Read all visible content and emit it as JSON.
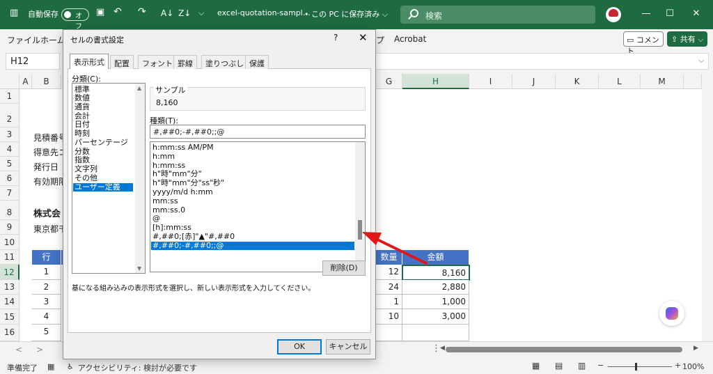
{
  "titlebar": {
    "autosave_label": "自動保存",
    "autosave_state": "オフ",
    "filename": "excel-quotation-sampl…",
    "save_location": "• この PC に保存済み ⌵",
    "search_placeholder": "検索",
    "accent_color": "#1e6b41"
  },
  "ribbon": {
    "file": "ファイル",
    "home": "ホーム",
    "help_fragment": "プ",
    "acrobat": "Acrobat",
    "comment_button": "コメント",
    "share_button": "共有 ⌵"
  },
  "formula_bar": {
    "name_box": "H12",
    "formula": ""
  },
  "grid": {
    "columns": [
      "A",
      "B",
      "G",
      "H",
      "I",
      "J",
      "K",
      "L",
      "M"
    ],
    "selected_column": "H",
    "rows": [
      "1",
      "2",
      "3",
      "4",
      "5",
      "6",
      "7",
      "8",
      "9",
      "10",
      "11",
      "12",
      "13",
      "14",
      "15",
      "16"
    ],
    "selected_row": "12",
    "partial_texts": {
      "r3": "見積番号",
      "r4": "得意先コ",
      "r5": "発行日",
      "r6": "有効期限",
      "r8": "株式会",
      "r9": "東京都千"
    },
    "table": {
      "header_row_label": "行",
      "header_qty": "数量",
      "header_amount": "金額",
      "rows": [
        {
          "no": "1",
          "qty": "12",
          "amount": "8,160"
        },
        {
          "no": "2",
          "qty": "24",
          "amount": "2,880"
        },
        {
          "no": "3",
          "qty": "1",
          "amount": "1,000"
        },
        {
          "no": "4",
          "qty": "10",
          "amount": "3,000"
        },
        {
          "no": "5",
          "qty": "",
          "amount": ""
        }
      ],
      "header_color": "#4472c4"
    }
  },
  "dialog": {
    "title": "セルの書式設定",
    "help": "?",
    "close": "✕",
    "tabs": [
      "表示形式",
      "配置",
      "フォント",
      "罫線",
      "塗りつぶし",
      "保護"
    ],
    "active_tab": "表示形式",
    "category_label": "分類(C):",
    "categories": [
      "標準",
      "数値",
      "通貨",
      "会計",
      "日付",
      "時刻",
      "パーセンテージ",
      "分数",
      "指数",
      "文字列",
      "その他",
      "ユーザー定義"
    ],
    "selected_category": "ユーザー定義",
    "sample_label": "サンプル",
    "sample_value": "8,160",
    "type_label": "種類(T):",
    "type_value": "#,##0;-#,##0;;@",
    "type_items": [
      "h:mm:ss AM/PM",
      "h:mm",
      "h:mm:ss",
      "h\"時\"mm\"分\"",
      "h\"時\"mm\"分\"ss\"秒\"",
      "yyyy/m/d h:mm",
      "mm:ss",
      "mm:ss.0",
      "@",
      "[h]:mm:ss",
      "#,##0;[赤]\"▲\"#,##0",
      "#,##0;-#,##0;;@"
    ],
    "selected_type": "#,##0;-#,##0;;@",
    "delete_button": "削除(D)",
    "hint": "基になる組み込みの表示形式を選択し、新しい表示形式を入力してください。",
    "ok_button": "OK",
    "cancel_button": "キャンセル",
    "selection_color": "#0078d7"
  },
  "statusbar": {
    "ready": "準備完了",
    "accessibility": "アクセシビリティ: 検討が必要です",
    "zoom": "100%",
    "zoom_percent": 100
  },
  "annotation": {
    "arrow_color": "#e0161b"
  }
}
